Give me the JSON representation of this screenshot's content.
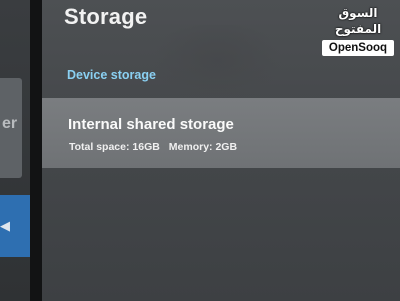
{
  "settings": {
    "title": "Storage",
    "section_header": "Device storage",
    "storage_item": {
      "name": "Internal shared storage",
      "total_space_label": "Total space: 16GB",
      "memory_label": "Memory: 2GB"
    }
  },
  "left_panel": {
    "partial_text": "er"
  },
  "watermark": {
    "arabic": "السوق المفتوح",
    "latin": "OpenSooq"
  },
  "colors": {
    "section_header": "#8ad0f2",
    "focus_blue": "#2e6fb1",
    "highlight_row": "#7a7d80"
  }
}
